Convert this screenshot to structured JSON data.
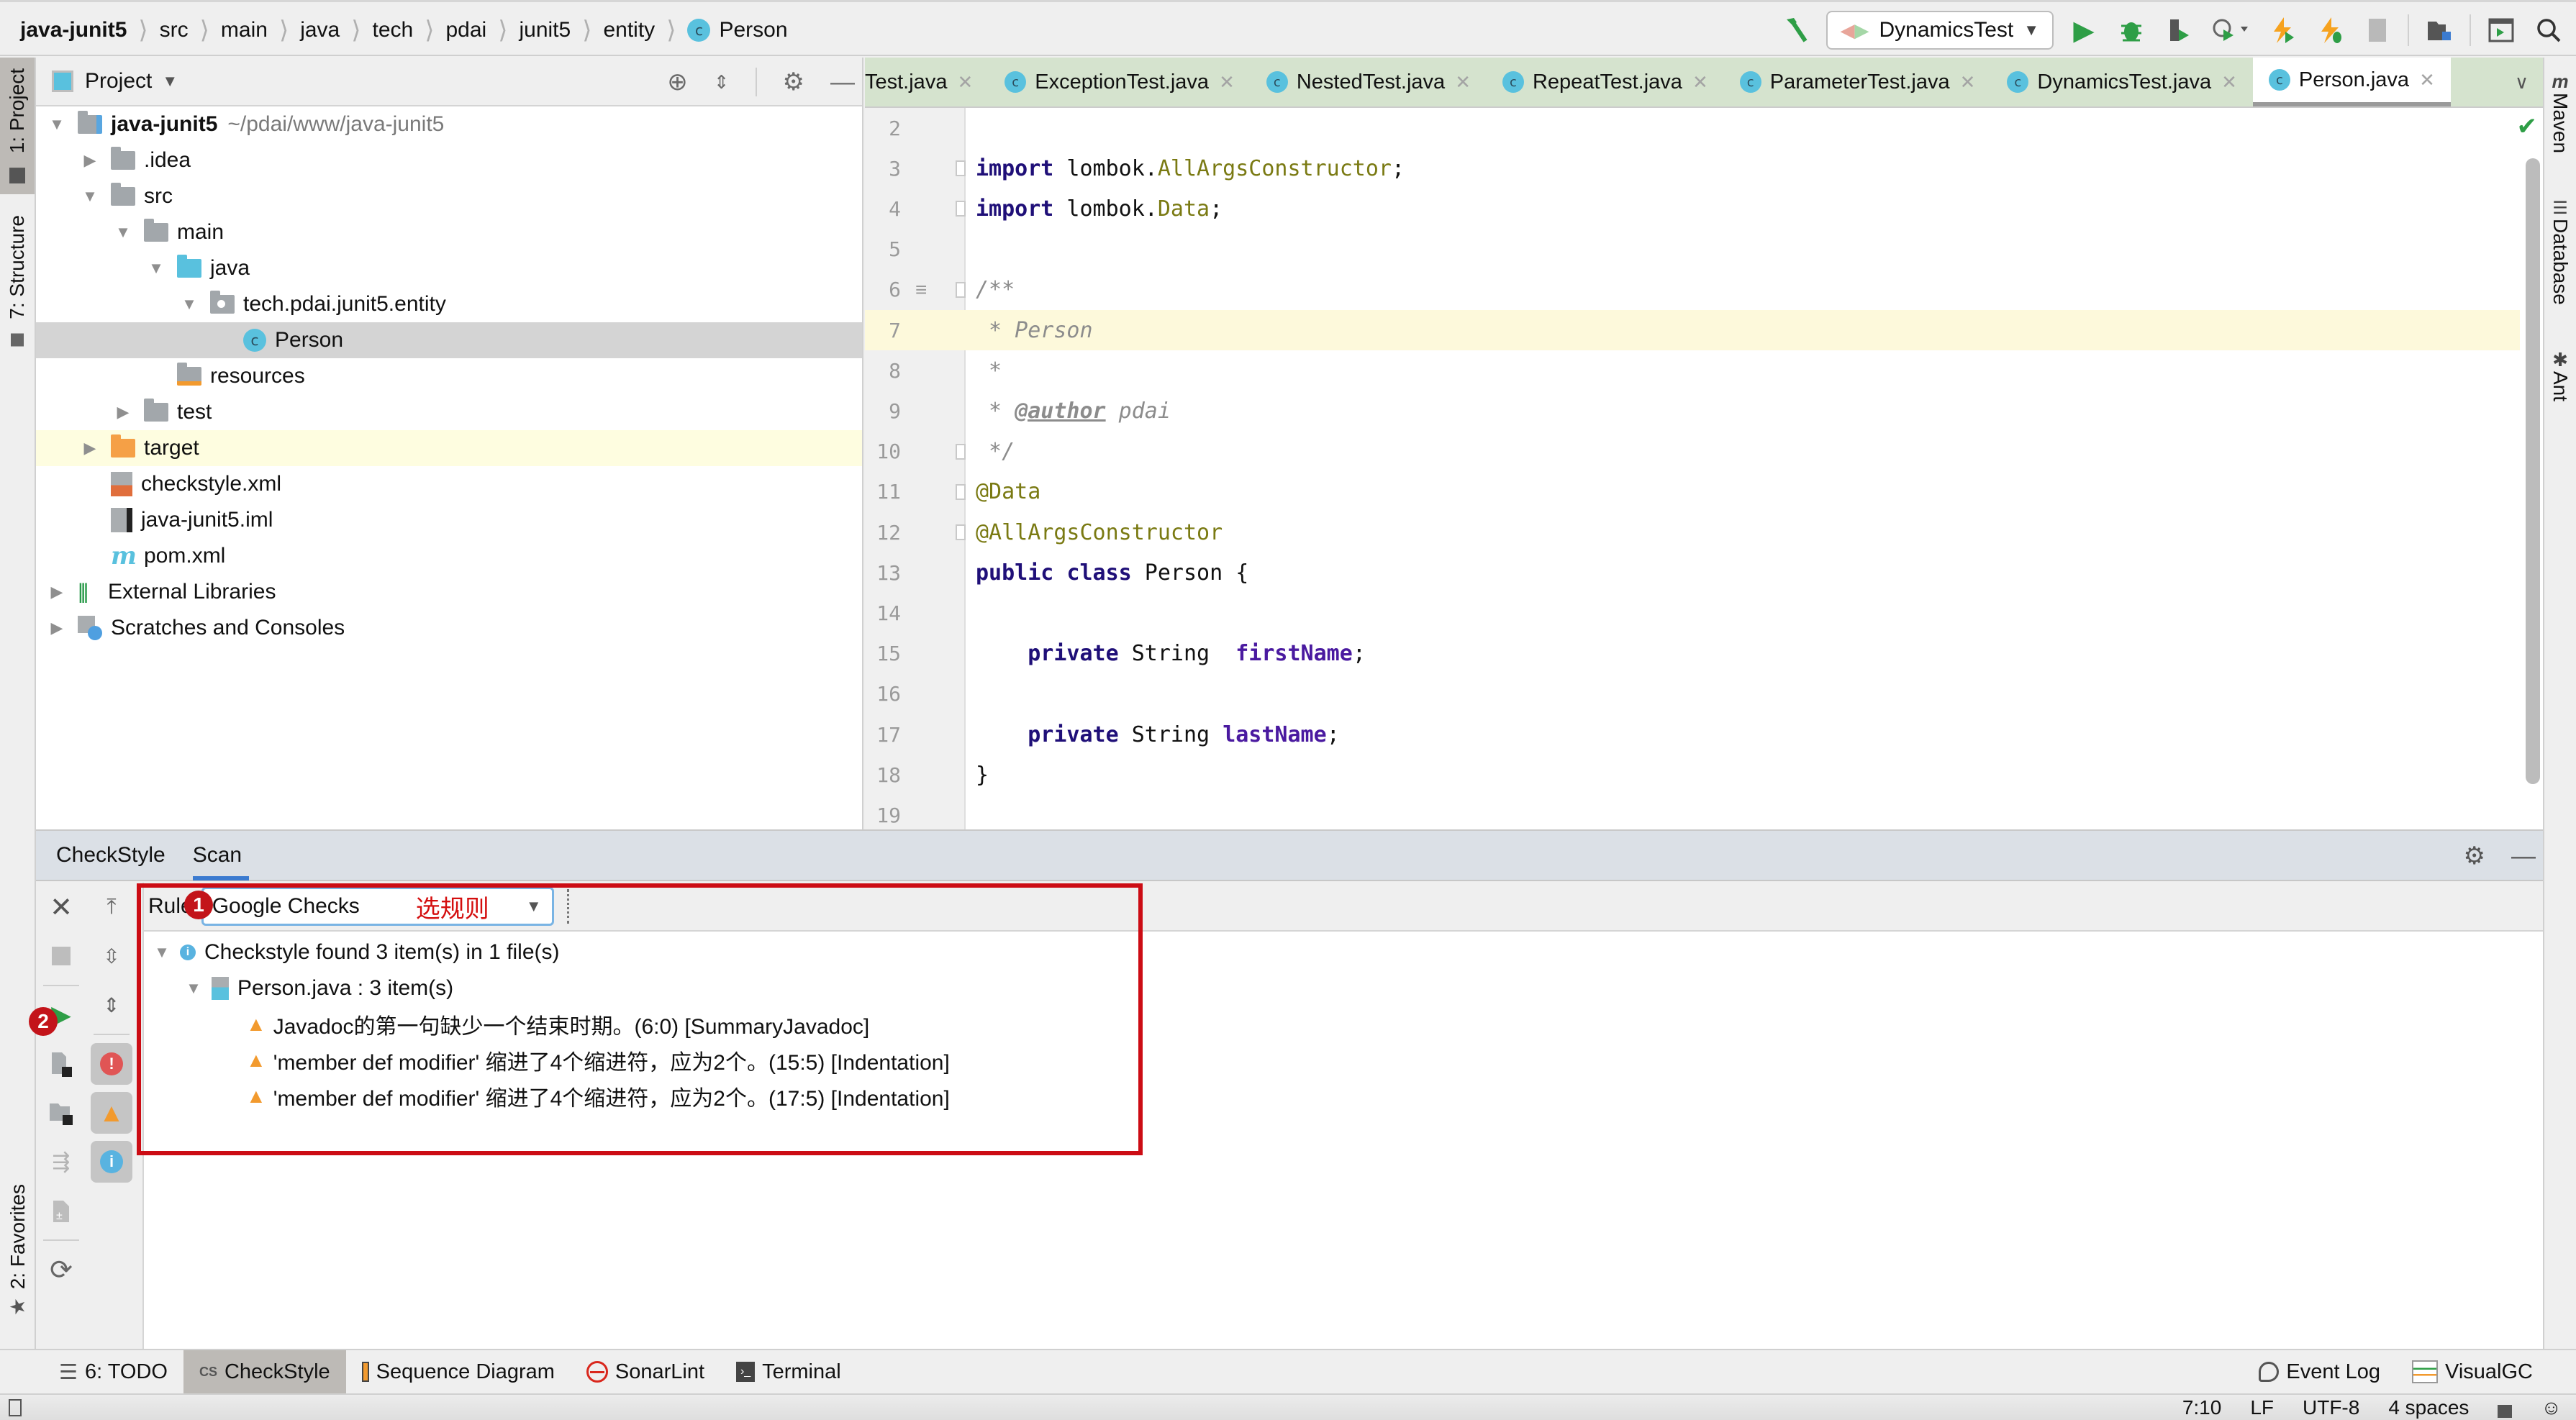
{
  "breadcrumb": [
    "java-junit5",
    "src",
    "main",
    "java",
    "tech",
    "pdai",
    "junit5",
    "entity",
    "Person"
  ],
  "toolbar": {
    "run_config": "DynamicsTest",
    "icons": [
      "build-hammer-icon",
      "run-icon",
      "debug-icon",
      "coverage-icon",
      "profile-icon",
      "hot-reload-run-icon",
      "hot-reload-debug-icon",
      "stop-icon",
      "project-structure-icon",
      "terminal-run-icon",
      "search-icon"
    ]
  },
  "left_stripe": {
    "project": "1: Project",
    "structure": "7: Structure",
    "favorites": "2: Favorites"
  },
  "right_stripe": [
    "Maven",
    "Database",
    "Ant"
  ],
  "project_panel": {
    "title": "Project",
    "tree": [
      {
        "label": "java-junit5",
        "path": "~/pdai/www/java-junit5",
        "depth": 0,
        "arrow": "down",
        "icon": "module",
        "bold": true
      },
      {
        "label": ".idea",
        "depth": 1,
        "arrow": "right",
        "icon": "folder"
      },
      {
        "label": "src",
        "depth": 1,
        "arrow": "down",
        "icon": "folder"
      },
      {
        "label": "main",
        "depth": 2,
        "arrow": "down",
        "icon": "folder"
      },
      {
        "label": "java",
        "depth": 3,
        "arrow": "down",
        "icon": "folder-blue"
      },
      {
        "label": "tech.pdai.junit5.entity",
        "depth": 4,
        "arrow": "down",
        "icon": "package"
      },
      {
        "label": "Person",
        "depth": 5,
        "arrow": "none",
        "icon": "class",
        "selected": true
      },
      {
        "label": "resources",
        "depth": 3,
        "arrow": "none",
        "icon": "resources"
      },
      {
        "label": "test",
        "depth": 2,
        "arrow": "right",
        "icon": "folder"
      },
      {
        "label": "target",
        "depth": 1,
        "arrow": "right",
        "icon": "folder-orange",
        "highlight": true
      },
      {
        "label": "checkstyle.xml",
        "depth": 1,
        "arrow": "none",
        "icon": "xml"
      },
      {
        "label": "java-junit5.iml",
        "depth": 1,
        "arrow": "none",
        "icon": "iml"
      },
      {
        "label": "pom.xml",
        "depth": 1,
        "arrow": "none",
        "icon": "maven"
      },
      {
        "label": "External Libraries",
        "depth": 0,
        "arrow": "right",
        "icon": "libraries"
      },
      {
        "label": "Scratches and Consoles",
        "depth": 0,
        "arrow": "right",
        "icon": "scratches"
      }
    ]
  },
  "editor": {
    "tabs": [
      {
        "label": "Test.java",
        "icon": false
      },
      {
        "label": "ExceptionTest.java",
        "icon": true
      },
      {
        "label": "NestedTest.java",
        "icon": true
      },
      {
        "label": "RepeatTest.java",
        "icon": true
      },
      {
        "label": "ParameterTest.java",
        "icon": true
      },
      {
        "label": "DynamicsTest.java",
        "icon": true
      },
      {
        "label": "Person.java",
        "icon": true,
        "active": true
      }
    ],
    "current_line": 7,
    "lines": [
      {
        "n": "2",
        "tokens": []
      },
      {
        "n": "3",
        "tokens": [
          [
            "kw",
            "import"
          ],
          [
            "plain",
            " lombok."
          ],
          [
            "ann",
            "AllArgsConstructor"
          ],
          [
            "plain",
            ";"
          ]
        ]
      },
      {
        "n": "4",
        "tokens": [
          [
            "kw",
            "import"
          ],
          [
            "plain",
            " lombok."
          ],
          [
            "ann",
            "Data"
          ],
          [
            "plain",
            ";"
          ]
        ]
      },
      {
        "n": "5",
        "tokens": []
      },
      {
        "n": "6",
        "tokens": [
          [
            "cmt",
            "/**"
          ]
        ]
      },
      {
        "n": "7",
        "tokens": [
          [
            "cmt",
            " * Person"
          ]
        ]
      },
      {
        "n": "8",
        "tokens": [
          [
            "cmt",
            " *"
          ]
        ]
      },
      {
        "n": "9",
        "tokens": [
          [
            "cmt",
            " * "
          ],
          [
            "tag",
            "@author"
          ],
          [
            "cmt",
            " pdai"
          ]
        ]
      },
      {
        "n": "10",
        "tokens": [
          [
            "cmt",
            " */"
          ]
        ]
      },
      {
        "n": "11",
        "tokens": [
          [
            "ann",
            "@Data"
          ]
        ]
      },
      {
        "n": "12",
        "tokens": [
          [
            "ann",
            "@AllArgsConstructor"
          ]
        ]
      },
      {
        "n": "13",
        "tokens": [
          [
            "kw",
            "public"
          ],
          [
            "plain",
            " "
          ],
          [
            "kw",
            "class"
          ],
          [
            "plain",
            " Person {"
          ]
        ]
      },
      {
        "n": "14",
        "tokens": []
      },
      {
        "n": "15",
        "tokens": [
          [
            "plain",
            "    "
          ],
          [
            "kw",
            "private"
          ],
          [
            "plain",
            " String  "
          ],
          [
            "fld",
            "firstName"
          ],
          [
            "plain",
            ";"
          ]
        ]
      },
      {
        "n": "16",
        "tokens": []
      },
      {
        "n": "17",
        "tokens": [
          [
            "plain",
            "    "
          ],
          [
            "kw",
            "private"
          ],
          [
            "plain",
            " String "
          ],
          [
            "fld",
            "lastName"
          ],
          [
            "plain",
            ";"
          ]
        ]
      },
      {
        "n": "18",
        "tokens": [
          [
            "plain",
            "}"
          ]
        ]
      },
      {
        "n": "19",
        "tokens": []
      }
    ]
  },
  "checkstyle": {
    "tabs": [
      "CheckStyle",
      "Scan"
    ],
    "active_tab": "Scan",
    "rules_label": "Rules:",
    "rules_label_visible": "Rule",
    "rules_value": "Google Checks",
    "annotation_select_rule": "选规则",
    "step1": "1",
    "step2": "2",
    "summary": "Checkstyle found 3 item(s) in 1 file(s)",
    "file": "Person.java : 3 item(s)",
    "items": [
      "Javadoc的第一句缺少一个结束时期。(6:0) [SummaryJavadoc]",
      "'member def modifier' 缩进了4个缩进符，应为2个。(15:5) [Indentation]",
      "'member def modifier' 缩进了4个缩进符，应为2个。(17:5) [Indentation]"
    ]
  },
  "tool_strip": {
    "left": [
      "6: TODO",
      "CheckStyle",
      "Sequence Diagram",
      "SonarLint",
      "Terminal"
    ],
    "active": "CheckStyle",
    "right": [
      "Event Log",
      "VisualGC"
    ]
  },
  "status_bar": {
    "position": "7:10",
    "line_sep": "LF",
    "encoding": "UTF-8",
    "indent": "4 spaces"
  },
  "colors": {
    "tab_bar_bg": "#d5e3ce",
    "annotation_red": "#cc0c14",
    "current_line": "#fdf9db",
    "keyword": "#1f0f78",
    "annotation": "#7a7a13"
  }
}
